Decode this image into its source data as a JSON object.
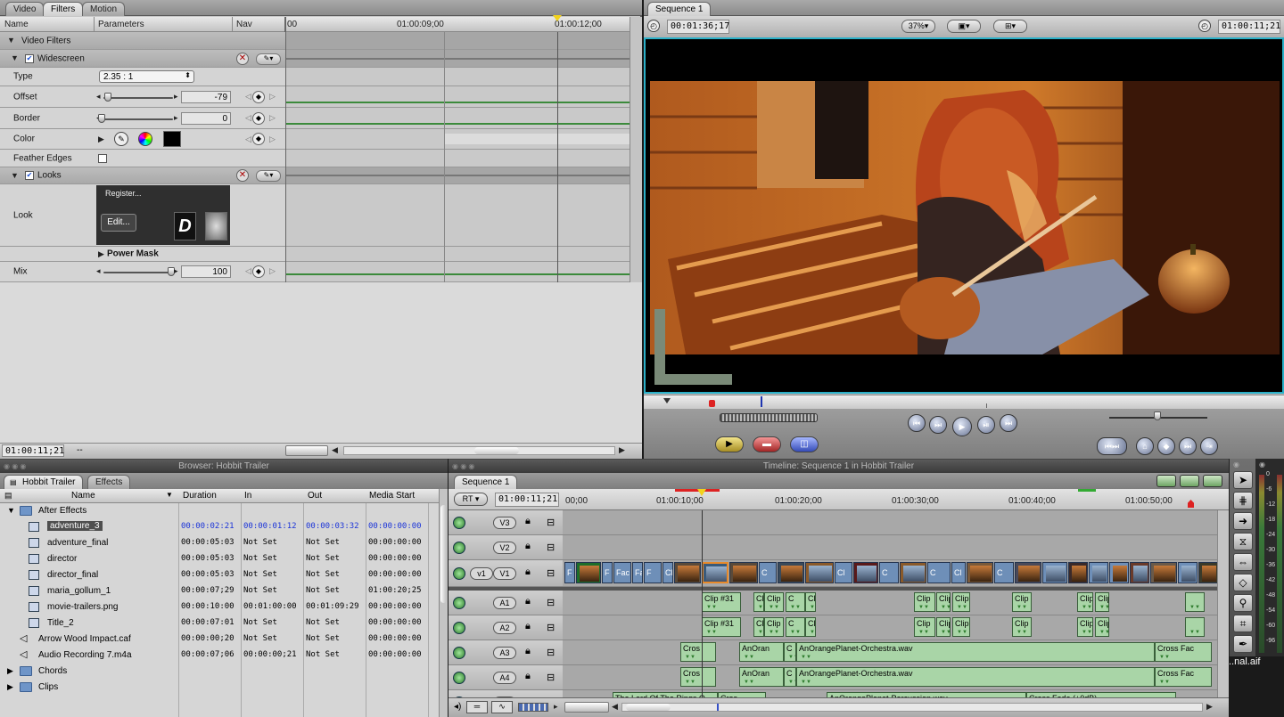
{
  "viewer": {
    "tabs": [
      "Video",
      "Filters",
      "Motion"
    ],
    "active_tab": "Filters",
    "columns": {
      "name": "Name",
      "parameters": "Parameters",
      "nav": "Nav"
    },
    "ruler": [
      "00",
      "01:00:09;00",
      "01:00:12;00"
    ],
    "groups": {
      "video_filters": "Video Filters",
      "widescreen": "Widescreen",
      "looks": "Looks",
      "power_mask": "Power Mask"
    },
    "params": {
      "type": {
        "label": "Type",
        "value": "2.35 : 1"
      },
      "offset": {
        "label": "Offset",
        "value": "-79"
      },
      "border": {
        "label": "Border",
        "value": "0"
      },
      "color": {
        "label": "Color"
      },
      "feather": {
        "label": "Feather Edges"
      },
      "look": {
        "label": "Look",
        "register": "Register...",
        "edit": "Edit..."
      },
      "mix": {
        "label": "Mix",
        "value": "100"
      }
    },
    "footer_tc": "01:00:11;21",
    "footer_dashes": "--"
  },
  "canvas": {
    "tab": "Sequence 1",
    "duration_tc": "00:01:36;17",
    "zoom": "37%",
    "current_tc": "01:00:11;21"
  },
  "browser": {
    "title": "Browser: Hobbit Trailer",
    "tabs": [
      "Hobbit Trailer",
      "Effects"
    ],
    "columns": {
      "name": "Name",
      "duration": "Duration",
      "in": "In",
      "out": "Out",
      "media_start": "Media Start"
    },
    "rows": [
      {
        "kind": "folder-open",
        "indent": 0,
        "name": "After Effects",
        "duration": "",
        "in": "",
        "out": "",
        "start": ""
      },
      {
        "kind": "seq",
        "indent": 1,
        "name": "adventure_3",
        "duration": "00:00:02:21",
        "in": "00:00:01:12",
        "out": "00:00:03:32",
        "start": "00:00:00:00",
        "selected": true
      },
      {
        "kind": "seq",
        "indent": 1,
        "name": "adventure_final",
        "duration": "00:00:05:03",
        "in": "Not Set",
        "out": "Not Set",
        "start": "00:00:00:00"
      },
      {
        "kind": "seq",
        "indent": 1,
        "name": "director",
        "duration": "00:00:05:03",
        "in": "Not Set",
        "out": "Not Set",
        "start": "00:00:00:00"
      },
      {
        "kind": "seq",
        "indent": 1,
        "name": "director_final",
        "duration": "00:00:05:03",
        "in": "Not Set",
        "out": "Not Set",
        "start": "00:00:00:00"
      },
      {
        "kind": "seq",
        "indent": 1,
        "name": "maria_gollum_1",
        "duration": "00:00:07;29",
        "in": "Not Set",
        "out": "Not Set",
        "start": "01:00:20;25"
      },
      {
        "kind": "seq",
        "indent": 1,
        "name": "movie-trailers.png",
        "duration": "00:00:10:00",
        "in": "00:01:00:00",
        "out": "00:01:09:29",
        "start": "00:00:00:00"
      },
      {
        "kind": "seq",
        "indent": 1,
        "name": "Title_2",
        "duration": "00:00:07:01",
        "in": "Not Set",
        "out": "Not Set",
        "start": "00:00:00:00"
      },
      {
        "kind": "audio",
        "indent": 0,
        "name": "Arrow Wood Impact.caf",
        "duration": "00:00:00;20",
        "in": "Not Set",
        "out": "Not Set",
        "start": "00:00:00:00"
      },
      {
        "kind": "audio",
        "indent": 0,
        "name": "Audio Recording 7.m4a",
        "duration": "00:00:07;06",
        "in": "00:00:00;21",
        "out": "Not Set",
        "start": "00:00:00:00"
      },
      {
        "kind": "folder",
        "indent": 0,
        "name": "Chords",
        "duration": "",
        "in": "",
        "out": "",
        "start": ""
      },
      {
        "kind": "folder",
        "indent": 0,
        "name": "Clips",
        "duration": "",
        "in": "",
        "out": "",
        "start": ""
      }
    ]
  },
  "timeline": {
    "title": "Timeline: Sequence 1 in Hobbit Trailer",
    "tab": "Sequence 1",
    "rt": "RT",
    "tc": "01:00:11;21",
    "ruler": [
      "00;00",
      "01:00:10;00",
      "01:00:20;00",
      "01:00:30;00",
      "01:00:40;00",
      "01:00:50;00"
    ],
    "tracks": {
      "v3": "V3",
      "v2": "V2",
      "v1": "V1",
      "v1src": "v1",
      "a1": "A1",
      "a2": "A2",
      "a3": "A3",
      "a4": "A4",
      "a5": "A5"
    },
    "video_letters": [
      "F",
      "F",
      "Fac",
      "Fa",
      "F",
      "Cl",
      "C",
      "Cl",
      "C",
      "C",
      "Cl",
      "C"
    ],
    "a1_clips": [
      "Clip #31",
      "Clip",
      "Clip",
      "C",
      "Clip",
      "Clip",
      "Clip",
      "Clip",
      "Clip",
      "Clip",
      "Clip"
    ],
    "a2_clips": [
      "Clip #31",
      "Clip",
      "Clip",
      "C",
      "Clip",
      "Clip",
      "Clip",
      "Clip",
      "Clip",
      "Clip",
      "Clip"
    ],
    "a3_clips": [
      "Cros",
      "AnOran",
      "C",
      "AnOrangePlanet-Orchestra.wav",
      "Cross Fac"
    ],
    "a4_clips": [
      "Cros",
      "AnOran",
      "C",
      "AnOrangePlanet-Orchestra.wav",
      "Cross Fac"
    ],
    "a5_clips": [
      "The Lord Of The Rings O",
      "Cros",
      "AnOrangePlanet-Percussion.wav",
      "Cross Fade (+0dB)"
    ],
    "overflow_text": "..nal.aif"
  },
  "meters": {
    "ticks": [
      "0",
      "-6",
      "-12",
      "-18",
      "-24",
      "-30",
      "-36",
      "-42",
      "-48",
      "-54",
      "-60",
      "-96"
    ]
  },
  "colors": {
    "accent_canvas_border": "#2bb0c8",
    "audio_clip": "#a9d5a7",
    "video_clip": "#6e8fb8",
    "playhead": "#f2d21b"
  }
}
